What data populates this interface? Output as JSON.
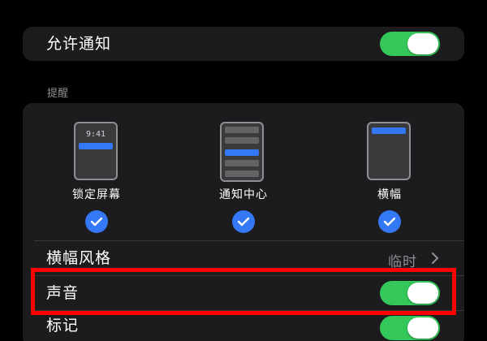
{
  "notifications": {
    "allow_label": "允许通知",
    "allow_enabled": true
  },
  "alerts_section": {
    "title": "提醒",
    "options": [
      {
        "label": "锁定屏幕",
        "preview_time": "9:41",
        "checked": true
      },
      {
        "label": "通知中心",
        "checked": true
      },
      {
        "label": "横幅",
        "checked": true
      }
    ]
  },
  "banner_style": {
    "label": "横幅风格",
    "value": "临时"
  },
  "sound": {
    "label": "声音",
    "enabled": true
  },
  "badge": {
    "label": "标记",
    "enabled": true
  },
  "colors": {
    "toggle_on": "#34c759",
    "accent_blue": "#3478f6",
    "highlight_red": "#ff0000"
  },
  "icons": [
    "checkmark-icon",
    "chevron-right-icon"
  ]
}
